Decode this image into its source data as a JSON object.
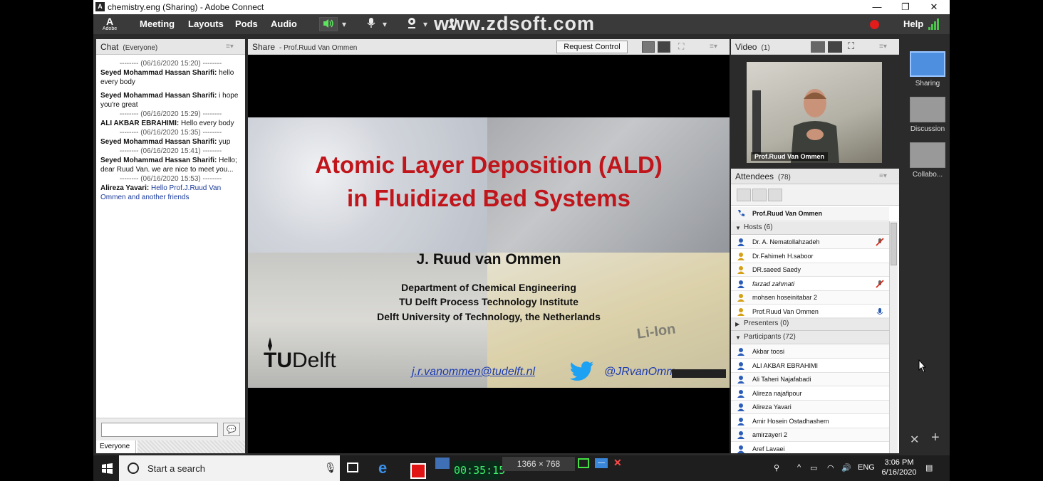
{
  "window": {
    "title": "chemistry.eng (Sharing) - Adobe Connect",
    "minimize": "—",
    "maximize": "❐",
    "close": "✕"
  },
  "menubar": {
    "logo_text": "Adobe",
    "items": [
      "Meeting",
      "Layouts",
      "Pods",
      "Audio"
    ],
    "watermark": "www.zdsoft.com",
    "help": "Help",
    "record_color": "#e21b1b"
  },
  "chat": {
    "title": "Chat",
    "scope": "(Everyone)",
    "messages": [
      {
        "sep": "-------- (06/16/2020 15:20) --------"
      },
      {
        "author": "Seyed Mohammad Hassan Sharifi:",
        "text": " hello every body"
      },
      {
        "author": "Seyed Mohammad Hassan Sharifi:",
        "text": " i hope you're great"
      },
      {
        "sep": "-------- (06/16/2020 15:29) --------"
      },
      {
        "author": "ALI AKBAR EBRAHIMI:",
        "text": " Hello every body"
      },
      {
        "sep": "-------- (06/16/2020 15:35) --------"
      },
      {
        "author": "Seyed Mohammad Hassan Sharifi:",
        "text": " yup"
      },
      {
        "sep": "-------- (06/16/2020 15:41) --------"
      },
      {
        "author": "Seyed Mohammad Hassan Sharifi:",
        "text": " Hello; dear Ruud Van. we are nice to meet you..."
      },
      {
        "sep": "-------- (06/16/2020 15:53) --------"
      },
      {
        "author": "Alireza Yavari:",
        "text": " Hello Prof.J.Ruud Van Ommen and another friends",
        "blue": true
      }
    ],
    "input_value": "",
    "tab_label": "Everyone"
  },
  "share": {
    "title": "Share",
    "presenter": "- Prof.Ruud Van Ommen",
    "request_control": "Request Control",
    "slide": {
      "title_line1": "Atomic Layer Deposition (ALD)",
      "title_line2": "in Fluidized Bed Systems",
      "author": "J. Ruud van Ommen",
      "dept": "Department of Chemical Engineering",
      "inst": "TU Delft Process Technology Institute",
      "univ": "Delft University of Technology, the Netherlands",
      "logo_tu": "TU",
      "logo_delft": "Delft",
      "email": "j.r.vanommen@tudelft.nl",
      "handle": "@JRvanOmm",
      "battery_label": "Li-Ion",
      "title_color": "#c0151b"
    }
  },
  "video": {
    "title": "Video",
    "count": "(1)",
    "name": "Prof.Ruud Van Ommen"
  },
  "attendees": {
    "title": "Attendees",
    "count": "(78)",
    "presenter_row": "Prof.Ruud Van Ommen",
    "hosts_label": "Hosts (6)",
    "hosts": [
      "Dr. A. Nematollahzadeh",
      "Dr.Fahimeh H.saboor",
      "DR.saeed Saedy",
      "farzad zahmati",
      "mohsen hoseinitabar 2",
      "Prof.Ruud Van Ommen"
    ],
    "presenters_label": "Presenters (0)",
    "participants_label": "Participants (72)",
    "participants": [
      "Akbar toosi",
      "ALI AKBAR EBRAHIMI",
      "Ali Taheri Najafabadi",
      "Alireza najafipour",
      "Alireza Yavari",
      "Amir Hosein Ostadhashem",
      "amirzayeri 2",
      "Aref Lavaei"
    ]
  },
  "layouts": {
    "items": [
      "Sharing",
      "Discussion",
      "Collabo..."
    ]
  },
  "taskbar": {
    "search_placeholder": "Start a search",
    "recorder_time": "00:35:15",
    "resolution": "1366 × 768",
    "lang": "ENG",
    "time": "3:06 PM",
    "date": "6/16/2020"
  }
}
